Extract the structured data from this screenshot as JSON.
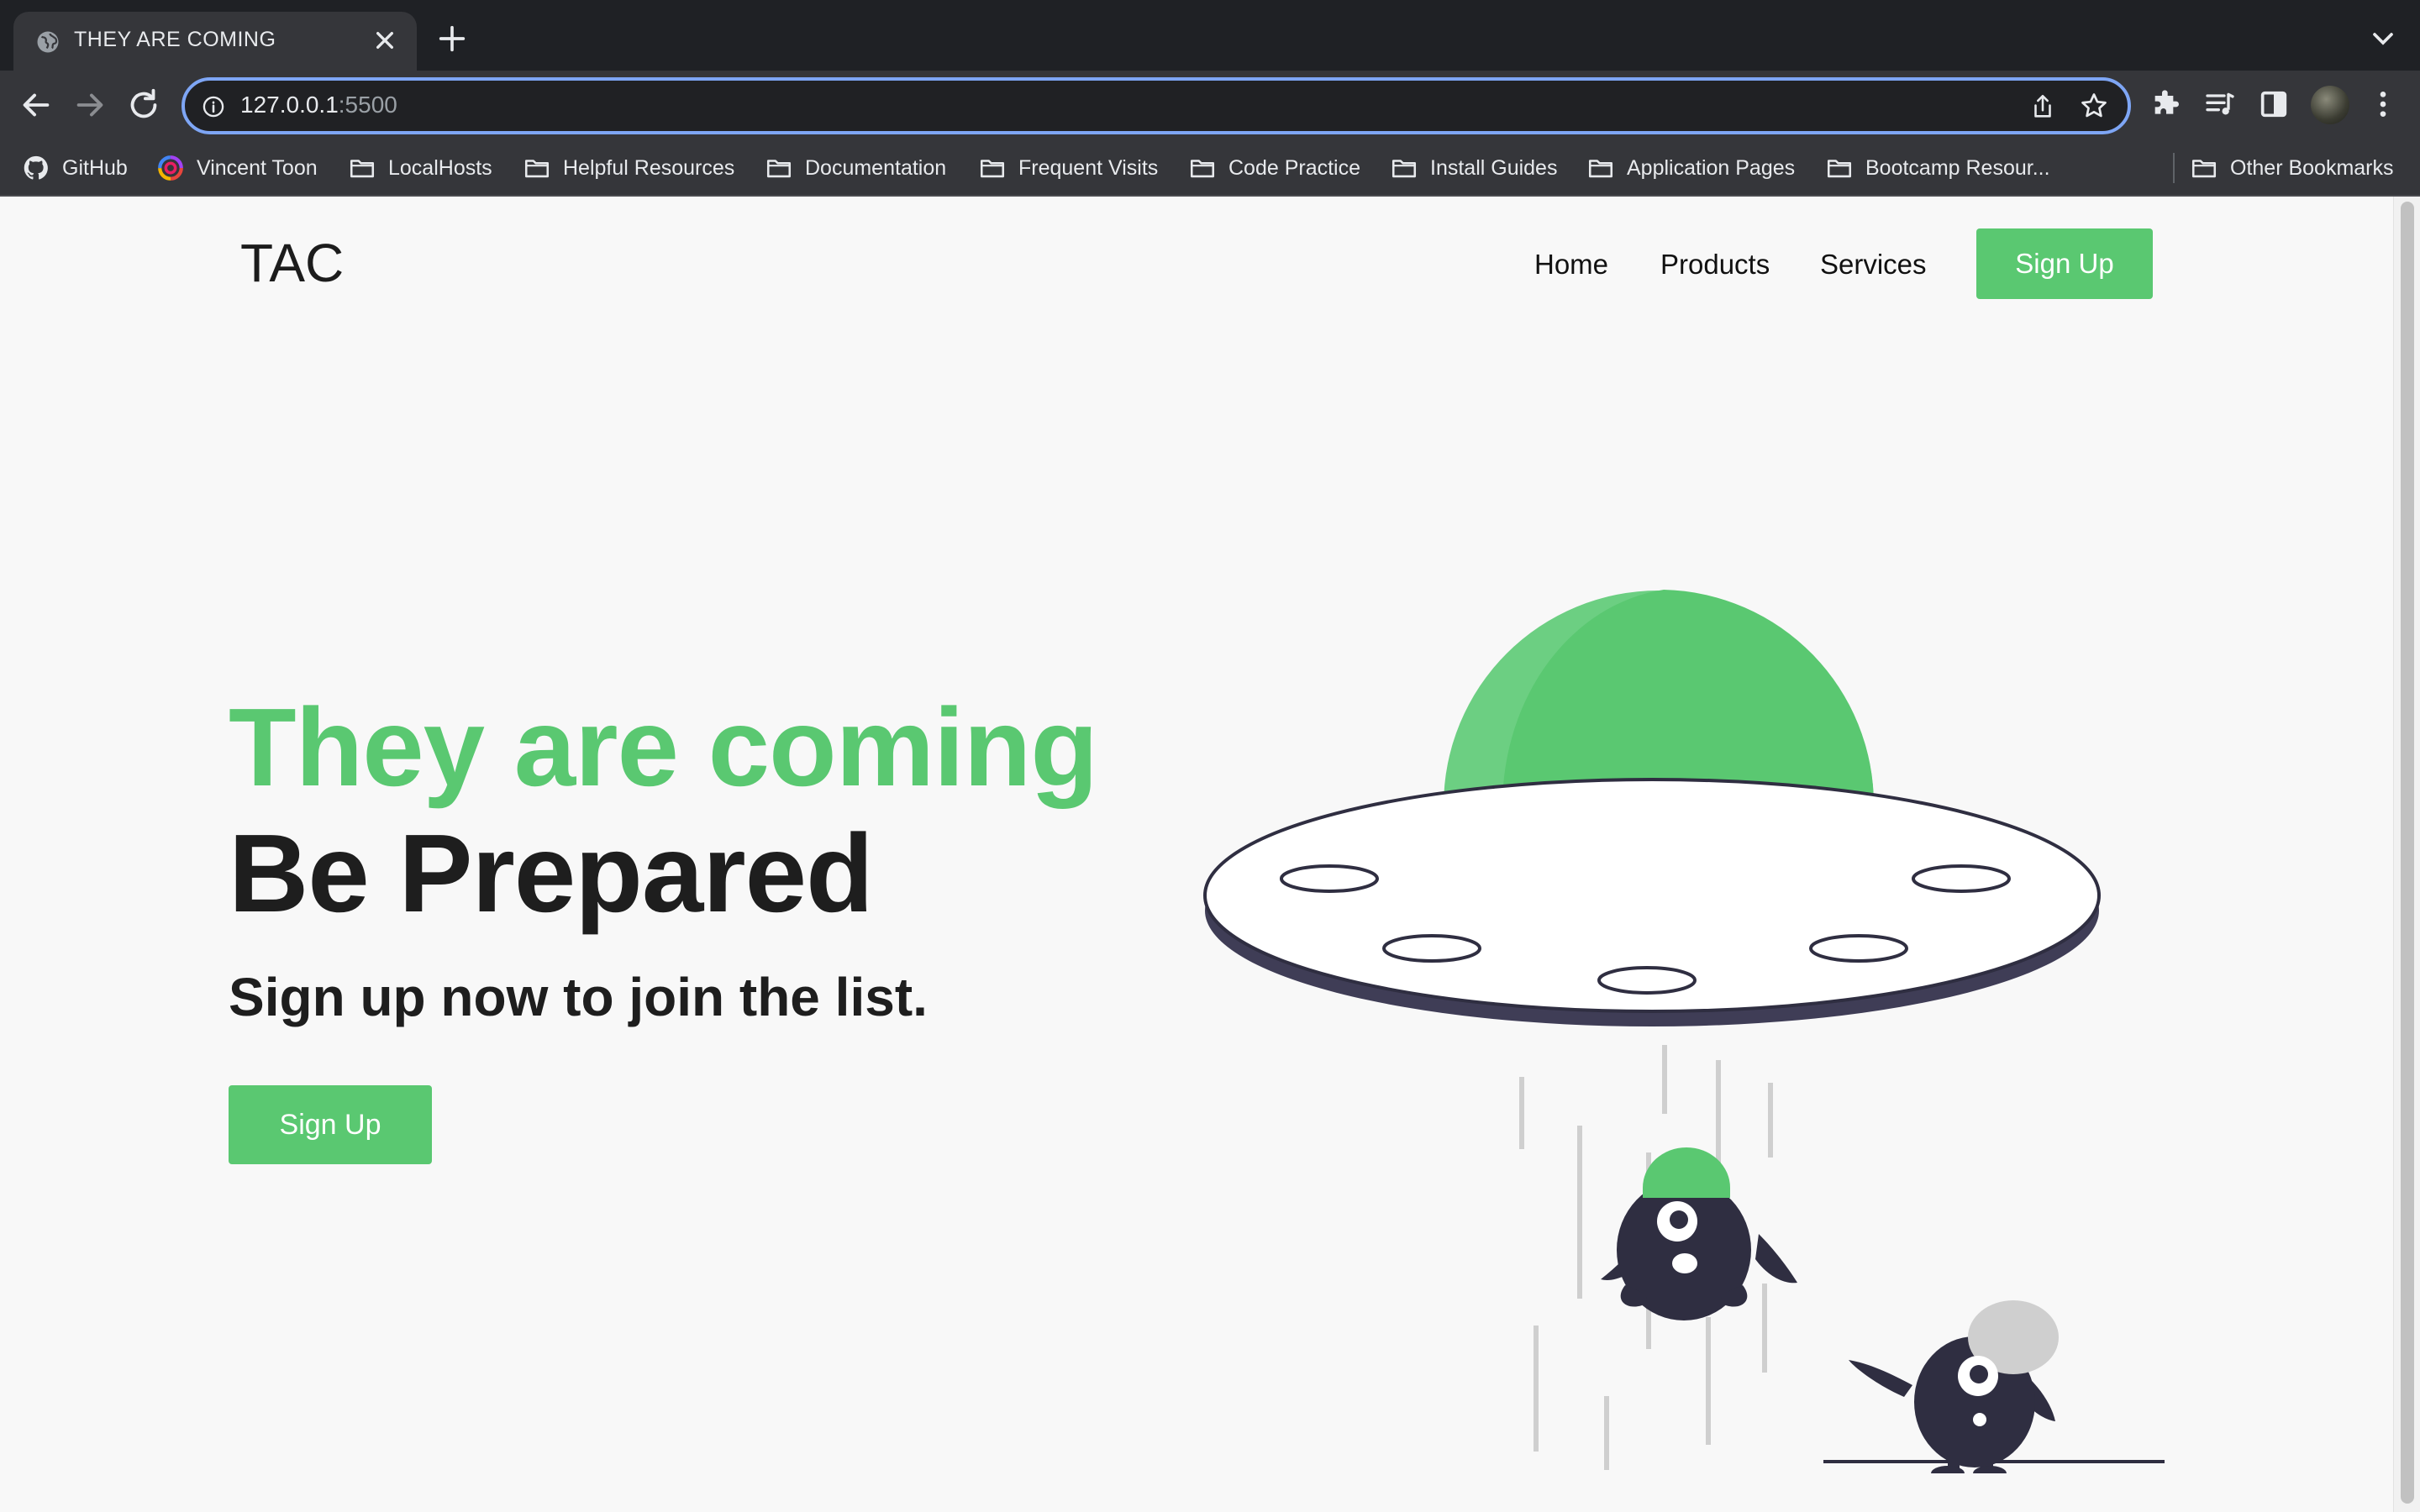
{
  "browser": {
    "tab": {
      "title": "THEY ARE COMING",
      "favicon": "globe-icon"
    },
    "address": {
      "host": "127.0.0.1",
      "port": ":5500"
    },
    "bookmarks": [
      {
        "label": "GitHub",
        "icon": "github-icon"
      },
      {
        "label": "Vincent Toon",
        "icon": "colorful-swirl-icon"
      },
      {
        "label": "LocalHosts",
        "icon": "folder-icon"
      },
      {
        "label": "Helpful Resources",
        "icon": "folder-icon"
      },
      {
        "label": "Documentation",
        "icon": "folder-icon"
      },
      {
        "label": "Frequent Visits",
        "icon": "folder-icon"
      },
      {
        "label": "Code Practice",
        "icon": "folder-icon"
      },
      {
        "label": "Install Guides",
        "icon": "folder-icon"
      },
      {
        "label": "Application Pages",
        "icon": "folder-icon"
      },
      {
        "label": "Bootcamp Resour...",
        "icon": "folder-icon"
      }
    ],
    "other_bookmarks": "Other Bookmarks"
  },
  "site": {
    "logo": "TAC",
    "nav": [
      "Home",
      "Products",
      "Services"
    ],
    "nav_cta": "Sign Up",
    "hero": {
      "headline": "They are coming",
      "subheadline": "Be Prepared",
      "tagline": "Sign up now to join the list.",
      "cta": "Sign Up"
    }
  },
  "colors": {
    "accent": "#5ac871",
    "dark": "#2f2e41",
    "text": "#1e1e1e",
    "background": "#f8f8f8",
    "chrome": "#35363a"
  }
}
